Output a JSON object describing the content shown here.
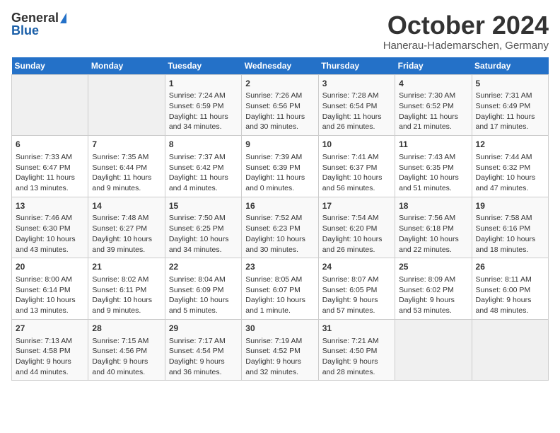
{
  "header": {
    "logo_general": "General",
    "logo_blue": "Blue",
    "month": "October 2024",
    "location": "Hanerau-Hademarschen, Germany"
  },
  "weekdays": [
    "Sunday",
    "Monday",
    "Tuesday",
    "Wednesday",
    "Thursday",
    "Friday",
    "Saturday"
  ],
  "weeks": [
    [
      {
        "day": "",
        "empty": true
      },
      {
        "day": "",
        "empty": true
      },
      {
        "day": "1",
        "lines": [
          "Sunrise: 7:24 AM",
          "Sunset: 6:59 PM",
          "Daylight: 11 hours",
          "and 34 minutes."
        ]
      },
      {
        "day": "2",
        "lines": [
          "Sunrise: 7:26 AM",
          "Sunset: 6:56 PM",
          "Daylight: 11 hours",
          "and 30 minutes."
        ]
      },
      {
        "day": "3",
        "lines": [
          "Sunrise: 7:28 AM",
          "Sunset: 6:54 PM",
          "Daylight: 11 hours",
          "and 26 minutes."
        ]
      },
      {
        "day": "4",
        "lines": [
          "Sunrise: 7:30 AM",
          "Sunset: 6:52 PM",
          "Daylight: 11 hours",
          "and 21 minutes."
        ]
      },
      {
        "day": "5",
        "lines": [
          "Sunrise: 7:31 AM",
          "Sunset: 6:49 PM",
          "Daylight: 11 hours",
          "and 17 minutes."
        ]
      }
    ],
    [
      {
        "day": "6",
        "lines": [
          "Sunrise: 7:33 AM",
          "Sunset: 6:47 PM",
          "Daylight: 11 hours",
          "and 13 minutes."
        ]
      },
      {
        "day": "7",
        "lines": [
          "Sunrise: 7:35 AM",
          "Sunset: 6:44 PM",
          "Daylight: 11 hours",
          "and 9 minutes."
        ]
      },
      {
        "day": "8",
        "lines": [
          "Sunrise: 7:37 AM",
          "Sunset: 6:42 PM",
          "Daylight: 11 hours",
          "and 4 minutes."
        ]
      },
      {
        "day": "9",
        "lines": [
          "Sunrise: 7:39 AM",
          "Sunset: 6:39 PM",
          "Daylight: 11 hours",
          "and 0 minutes."
        ]
      },
      {
        "day": "10",
        "lines": [
          "Sunrise: 7:41 AM",
          "Sunset: 6:37 PM",
          "Daylight: 10 hours",
          "and 56 minutes."
        ]
      },
      {
        "day": "11",
        "lines": [
          "Sunrise: 7:43 AM",
          "Sunset: 6:35 PM",
          "Daylight: 10 hours",
          "and 51 minutes."
        ]
      },
      {
        "day": "12",
        "lines": [
          "Sunrise: 7:44 AM",
          "Sunset: 6:32 PM",
          "Daylight: 10 hours",
          "and 47 minutes."
        ]
      }
    ],
    [
      {
        "day": "13",
        "lines": [
          "Sunrise: 7:46 AM",
          "Sunset: 6:30 PM",
          "Daylight: 10 hours",
          "and 43 minutes."
        ]
      },
      {
        "day": "14",
        "lines": [
          "Sunrise: 7:48 AM",
          "Sunset: 6:27 PM",
          "Daylight: 10 hours",
          "and 39 minutes."
        ]
      },
      {
        "day": "15",
        "lines": [
          "Sunrise: 7:50 AM",
          "Sunset: 6:25 PM",
          "Daylight: 10 hours",
          "and 34 minutes."
        ]
      },
      {
        "day": "16",
        "lines": [
          "Sunrise: 7:52 AM",
          "Sunset: 6:23 PM",
          "Daylight: 10 hours",
          "and 30 minutes."
        ]
      },
      {
        "day": "17",
        "lines": [
          "Sunrise: 7:54 AM",
          "Sunset: 6:20 PM",
          "Daylight: 10 hours",
          "and 26 minutes."
        ]
      },
      {
        "day": "18",
        "lines": [
          "Sunrise: 7:56 AM",
          "Sunset: 6:18 PM",
          "Daylight: 10 hours",
          "and 22 minutes."
        ]
      },
      {
        "day": "19",
        "lines": [
          "Sunrise: 7:58 AM",
          "Sunset: 6:16 PM",
          "Daylight: 10 hours",
          "and 18 minutes."
        ]
      }
    ],
    [
      {
        "day": "20",
        "lines": [
          "Sunrise: 8:00 AM",
          "Sunset: 6:14 PM",
          "Daylight: 10 hours",
          "and 13 minutes."
        ]
      },
      {
        "day": "21",
        "lines": [
          "Sunrise: 8:02 AM",
          "Sunset: 6:11 PM",
          "Daylight: 10 hours",
          "and 9 minutes."
        ]
      },
      {
        "day": "22",
        "lines": [
          "Sunrise: 8:04 AM",
          "Sunset: 6:09 PM",
          "Daylight: 10 hours",
          "and 5 minutes."
        ]
      },
      {
        "day": "23",
        "lines": [
          "Sunrise: 8:05 AM",
          "Sunset: 6:07 PM",
          "Daylight: 10 hours",
          "and 1 minute."
        ]
      },
      {
        "day": "24",
        "lines": [
          "Sunrise: 8:07 AM",
          "Sunset: 6:05 PM",
          "Daylight: 9 hours",
          "and 57 minutes."
        ]
      },
      {
        "day": "25",
        "lines": [
          "Sunrise: 8:09 AM",
          "Sunset: 6:02 PM",
          "Daylight: 9 hours",
          "and 53 minutes."
        ]
      },
      {
        "day": "26",
        "lines": [
          "Sunrise: 8:11 AM",
          "Sunset: 6:00 PM",
          "Daylight: 9 hours",
          "and 48 minutes."
        ]
      }
    ],
    [
      {
        "day": "27",
        "lines": [
          "Sunrise: 7:13 AM",
          "Sunset: 4:58 PM",
          "Daylight: 9 hours",
          "and 44 minutes."
        ]
      },
      {
        "day": "28",
        "lines": [
          "Sunrise: 7:15 AM",
          "Sunset: 4:56 PM",
          "Daylight: 9 hours",
          "and 40 minutes."
        ]
      },
      {
        "day": "29",
        "lines": [
          "Sunrise: 7:17 AM",
          "Sunset: 4:54 PM",
          "Daylight: 9 hours",
          "and 36 minutes."
        ]
      },
      {
        "day": "30",
        "lines": [
          "Sunrise: 7:19 AM",
          "Sunset: 4:52 PM",
          "Daylight: 9 hours",
          "and 32 minutes."
        ]
      },
      {
        "day": "31",
        "lines": [
          "Sunrise: 7:21 AM",
          "Sunset: 4:50 PM",
          "Daylight: 9 hours",
          "and 28 minutes."
        ]
      },
      {
        "day": "",
        "empty": true
      },
      {
        "day": "",
        "empty": true
      }
    ]
  ]
}
